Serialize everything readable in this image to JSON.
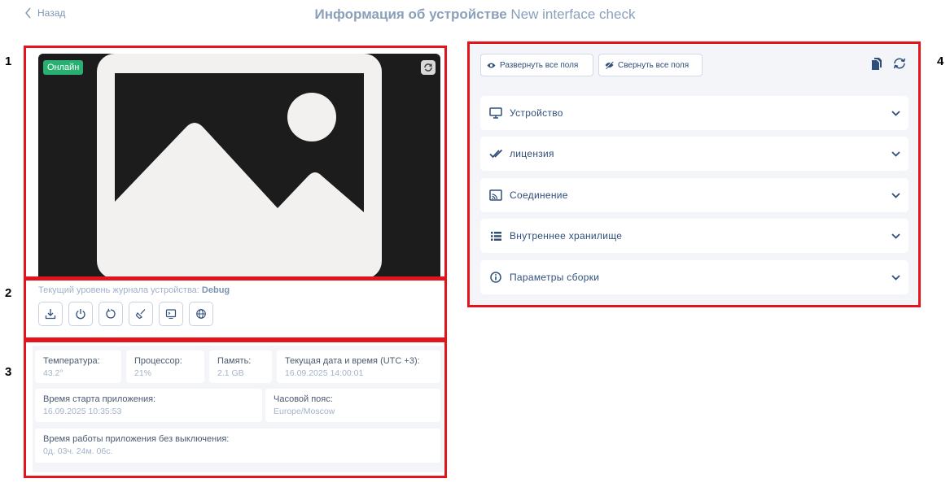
{
  "header": {
    "back_label": "Назад",
    "title": "Информация об устройстве",
    "device_name": "New interface check"
  },
  "callouts": [
    "1",
    "2",
    "3",
    "4"
  ],
  "preview": {
    "status_badge": "Онлайн",
    "status_color": "#27b070"
  },
  "log": {
    "label": "Текущий уровень журнала устройства:",
    "level": "Debug",
    "buttons": [
      "download-icon",
      "power-icon",
      "restart-icon",
      "clear-icon",
      "terminal-icon",
      "globe-icon"
    ]
  },
  "stats": {
    "temperature": {
      "label": "Температура:",
      "value": "43.2°"
    },
    "cpu": {
      "label": "Процессор:",
      "value": "21%"
    },
    "memory": {
      "label": "Память:",
      "value": "2.1 GB"
    },
    "datetime": {
      "label": "Текущая дата и время (UTC +3):",
      "value": "16.09.2025 14:00:01"
    },
    "app_start": {
      "label": "Время старта приложения:",
      "value": "16.09.2025 10:35:53"
    },
    "timezone": {
      "label": "Часовой пояс:",
      "value": "Europe/Moscow"
    },
    "uptime": {
      "label": "Время работы приложения без выключения:",
      "value": "0д. 03ч. 24м. 06с."
    }
  },
  "info": {
    "expand_all": "Развернуть все поля",
    "collapse_all": "Свернуть все поля",
    "sections": [
      "Устройство",
      "лицензия",
      "Соединение",
      "Внутреннее хранилище",
      "Параметры сборки"
    ]
  },
  "colors": {
    "accent": "#2f4f7a",
    "highlight": "#e3141b"
  }
}
